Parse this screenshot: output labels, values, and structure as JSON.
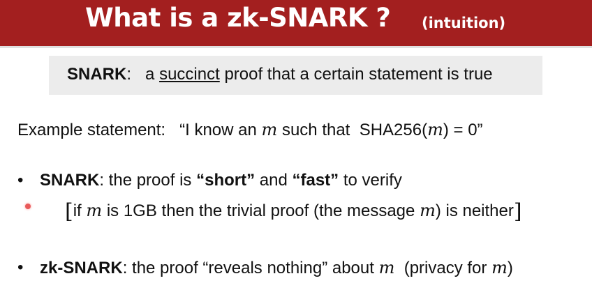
{
  "title": {
    "main": "What is a zk-SNARK ?",
    "sub": "(intuition)"
  },
  "definition": {
    "term": "SNARK",
    "colon": ":",
    "article": "a",
    "underlined": "succinct",
    "rest": "proof that a certain statement is true"
  },
  "example": {
    "label": "Example statement:",
    "quote_start": "“I know an",
    "var": "m",
    "mid": "such that",
    "func": "SHA256(",
    "var2": "m",
    "expr_end": ") = 0”"
  },
  "bullet1": {
    "marker": "•",
    "term": "SNARK",
    "text1": ":  the proof is",
    "short": "“short”",
    "and": "and",
    "fast": "“fast”",
    "text2": "to verify"
  },
  "bullet1_note": {
    "open": "[",
    "text1": "if",
    "var": "m",
    "text2": "is 1GB then the trivial proof (the message",
    "var2": "m",
    "text3": ") is neither",
    "close": "]"
  },
  "bullet2": {
    "marker": "•",
    "term": "zk-SNARK",
    "text1": ":  the proof “reveals nothing” about",
    "var": "m",
    "text2": "(privacy for",
    "var2": "m",
    "text3": ")"
  },
  "colors": {
    "title_bar": "#a31f1f",
    "definition_box": "#ececec",
    "pointer": "#e85a5a"
  }
}
